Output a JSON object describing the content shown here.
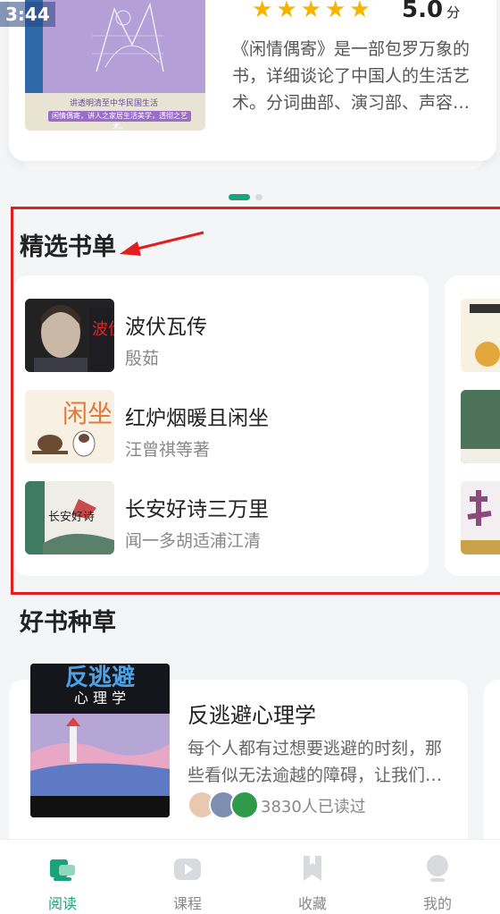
{
  "status": {
    "time": "3:44"
  },
  "hero": {
    "cover_caption": "讲透明清至中华民国生活",
    "cover_banner": "闲情偶寄，讲人之家居生活美学，透彻之艺术。",
    "stars": [
      "★",
      "★",
      "★",
      "★",
      "★"
    ],
    "rating_value": "5.0",
    "rating_unit": "分",
    "description": "《闲情偶寄》是一部包罗万象的书，详细谈论了中国人的生活艺术。分词曲部、演习部、声容部、居室部、器玩部、饮馔部、种植部、颐养部"
  },
  "carousel": {
    "count": 2,
    "active_index": 0
  },
  "booklist": {
    "section_title": "精选书单",
    "items": [
      {
        "title": "波伏瓦传",
        "author": "殷茹",
        "cover_text": "波伏瓦"
      },
      {
        "title": "红炉烟暖且闲坐",
        "author": "汪曾祺等著",
        "cover_text": "闲坐"
      },
      {
        "title": "长安好诗三万里",
        "author": "闻一多胡适浦江清",
        "cover_text": "长安好诗"
      }
    ]
  },
  "recommend": {
    "section_title": "好书种草",
    "book": {
      "title": "反逃避心理学",
      "cover_title": "反逃避",
      "cover_subtitle": "心 理 学",
      "description": "每个人都有过想要逃避的时刻，那些看似无法逾越的障碍，让我们想要退缩",
      "readers": "3830人已读过"
    }
  },
  "tabs": [
    {
      "label": "阅读",
      "icon": "book-reading-icon",
      "active": true
    },
    {
      "label": "课程",
      "icon": "video-play-icon",
      "active": false
    },
    {
      "label": "收藏",
      "icon": "bookmark-icon",
      "active": false
    },
    {
      "label": "我的",
      "icon": "profile-icon",
      "active": false
    }
  ],
  "colors": {
    "accent": "#1aa37a",
    "star": "#f5b400",
    "highlight": "#e02020"
  }
}
